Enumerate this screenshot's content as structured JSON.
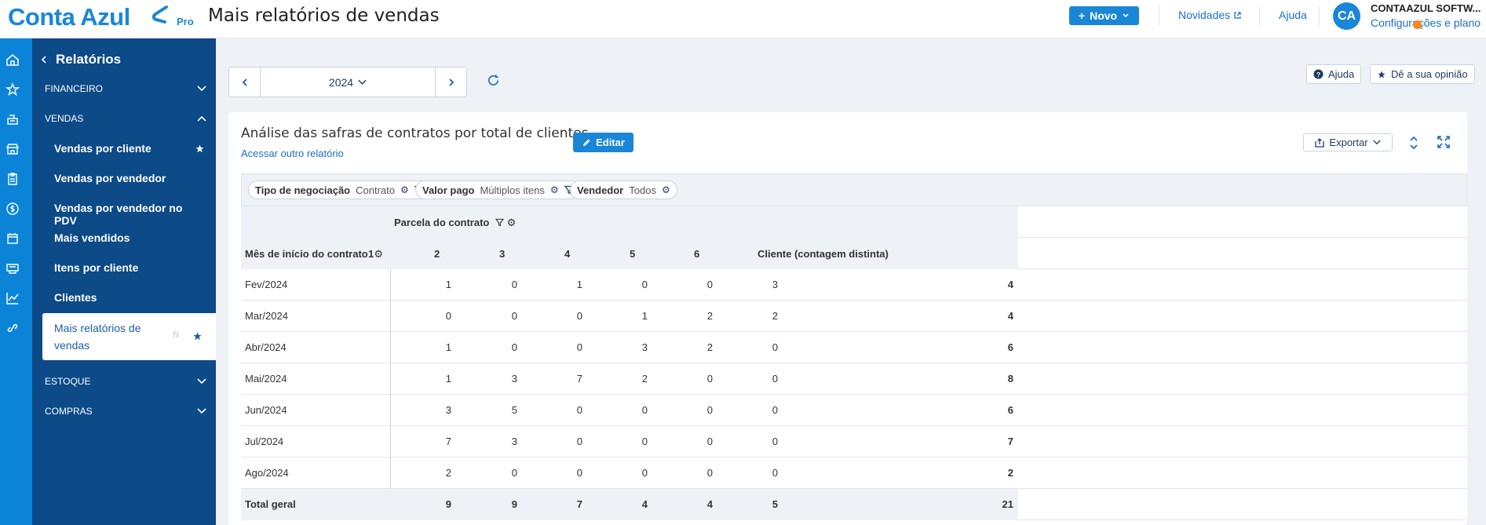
{
  "header": {
    "logo": "Conta Azul",
    "logo_badge": "Pro",
    "page_title": "Mais relatórios de vendas",
    "novo_label": "Novo",
    "novidades_label": "Novidades",
    "ajuda_label": "Ajuda",
    "avatar_initials": "CA",
    "account_name": "CONTAAZUL SOFTW...",
    "account_link": "Configurações e plano"
  },
  "sidebar": {
    "title": "Relatórios",
    "sections": [
      {
        "label": "FINANCEIRO",
        "expanded": false
      },
      {
        "label": "VENDAS",
        "expanded": true
      },
      {
        "label": "ESTOQUE",
        "expanded": false
      },
      {
        "label": "COMPRAS",
        "expanded": false
      }
    ],
    "items": [
      {
        "label": "Vendas por cliente",
        "favorite": true
      },
      {
        "label": "Vendas por vendedor"
      },
      {
        "label": "Vendas por vendedor no PDV"
      },
      {
        "label": "Mais vendidos"
      },
      {
        "label": "Itens por cliente"
      },
      {
        "label": "Clientes"
      },
      {
        "label": "Mais relatórios de vendas",
        "active": true,
        "favorite": true,
        "badge": "N"
      }
    ]
  },
  "toolbar": {
    "year": "2024",
    "ajuda_label": "Ajuda",
    "feedback_label": "Dê a sua opinião"
  },
  "report": {
    "title": "Análise das safras de contratos por total de clientes",
    "other_report_link": "Acessar outro relatório",
    "edit_label": "Editar",
    "export_label": "Exportar",
    "filters": [
      {
        "name": "Tipo de negociação",
        "value": "Contrato"
      },
      {
        "name": "Valor pago",
        "value": "Múltiplos itens"
      },
      {
        "name": "Vendedor",
        "value": "Todos"
      }
    ],
    "column_group_label": "Parcela do contrato",
    "row_header": "Mês de início do contrato",
    "columns": [
      "1",
      "2",
      "3",
      "4",
      "5",
      "6"
    ],
    "total_column": "Cliente (contagem distinta)",
    "rows": [
      {
        "month": "Fev/2024",
        "values": [
          "1",
          "0",
          "1",
          "0",
          "0",
          "3"
        ],
        "total": "4"
      },
      {
        "month": "Mar/2024",
        "values": [
          "0",
          "0",
          "0",
          "1",
          "2",
          "2"
        ],
        "total": "4"
      },
      {
        "month": "Abr/2024",
        "values": [
          "1",
          "0",
          "0",
          "3",
          "2",
          "0"
        ],
        "total": "6"
      },
      {
        "month": "Mai/2024",
        "values": [
          "1",
          "3",
          "7",
          "2",
          "0",
          "0"
        ],
        "total": "8"
      },
      {
        "month": "Jun/2024",
        "values": [
          "3",
          "5",
          "0",
          "0",
          "0",
          "0"
        ],
        "total": "6"
      },
      {
        "month": "Jul/2024",
        "values": [
          "7",
          "3",
          "0",
          "0",
          "0",
          "0"
        ],
        "total": "7"
      },
      {
        "month": "Ago/2024",
        "values": [
          "2",
          "0",
          "0",
          "0",
          "0",
          "0"
        ],
        "total": "2"
      }
    ],
    "grand_total": {
      "label": "Total geral",
      "values": [
        "9",
        "9",
        "7",
        "4",
        "4",
        "5"
      ],
      "total": "21"
    }
  },
  "colors": {
    "brand": "#1a86d8",
    "sidebar": "#0c4a88",
    "rail": "#0b84d8",
    "accent_dot": "#f08a1c"
  },
  "icons": [
    "home-icon",
    "star-icon",
    "cash-register-icon",
    "store-icon",
    "clipboard-icon",
    "dollar-icon",
    "calendar-icon",
    "chart-icon",
    "link-icon"
  ]
}
